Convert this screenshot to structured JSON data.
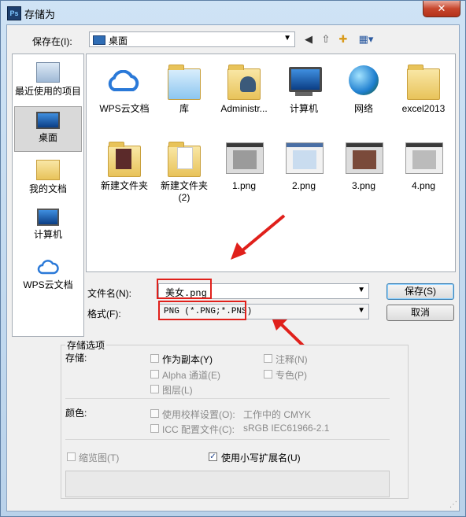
{
  "window": {
    "title": "存储为",
    "app_icon": "Ps",
    "close": "✕"
  },
  "save_in": {
    "label": "保存在(I):",
    "value": "桌面"
  },
  "places": [
    {
      "label": "最近使用的项目",
      "icon": "recent-icon"
    },
    {
      "label": "桌面",
      "icon": "desktop-icon",
      "selected": true
    },
    {
      "label": "我的文档",
      "icon": "documents-icon"
    },
    {
      "label": "计算机",
      "icon": "computer-icon"
    },
    {
      "label": "WPS云文档",
      "icon": "wps-cloud-icon"
    }
  ],
  "files": [
    {
      "name": "WPS云文档",
      "kind": "cloud"
    },
    {
      "name": "库",
      "kind": "library"
    },
    {
      "name": "Administr...",
      "kind": "user"
    },
    {
      "name": "计算机",
      "kind": "computer"
    },
    {
      "name": "网络",
      "kind": "network"
    },
    {
      "name": "excel2013",
      "kind": "folder"
    },
    {
      "name": "新建文件夹",
      "kind": "folder-photo"
    },
    {
      "name": "新建文件夹",
      "name2": "(2)",
      "kind": "folder-doc"
    },
    {
      "name": "1.png",
      "kind": "png"
    },
    {
      "name": "2.png",
      "kind": "png"
    },
    {
      "name": "3.png",
      "kind": "png"
    },
    {
      "name": "4.png",
      "kind": "png"
    }
  ],
  "filename": {
    "label": "文件名(N):",
    "value": "美女.png"
  },
  "format": {
    "label": "格式(F):",
    "value": "PNG (*.PNG;*.PNS)"
  },
  "buttons": {
    "save": "保存(S)",
    "cancel": "取消"
  },
  "options": {
    "group_title": "存储选项",
    "save_label": "存储:",
    "as_copy": "作为副本(Y)",
    "annotations": "注释(N)",
    "alpha": "Alpha 通道(E)",
    "spot": "专色(P)",
    "layers": "图层(L)",
    "color_label": "颜色:",
    "proof": "使用校样设置(O):",
    "proof_value": "工作中的 CMYK",
    "icc": "ICC 配置文件(C):",
    "icc_value": "sRGB IEC61966-2.1",
    "thumbnail": "缩览图(T)",
    "lowercase_ext": "使用小写扩展名(U)"
  },
  "colors": {
    "highlight": "#e0201b",
    "accent": "#3c7fb1"
  }
}
